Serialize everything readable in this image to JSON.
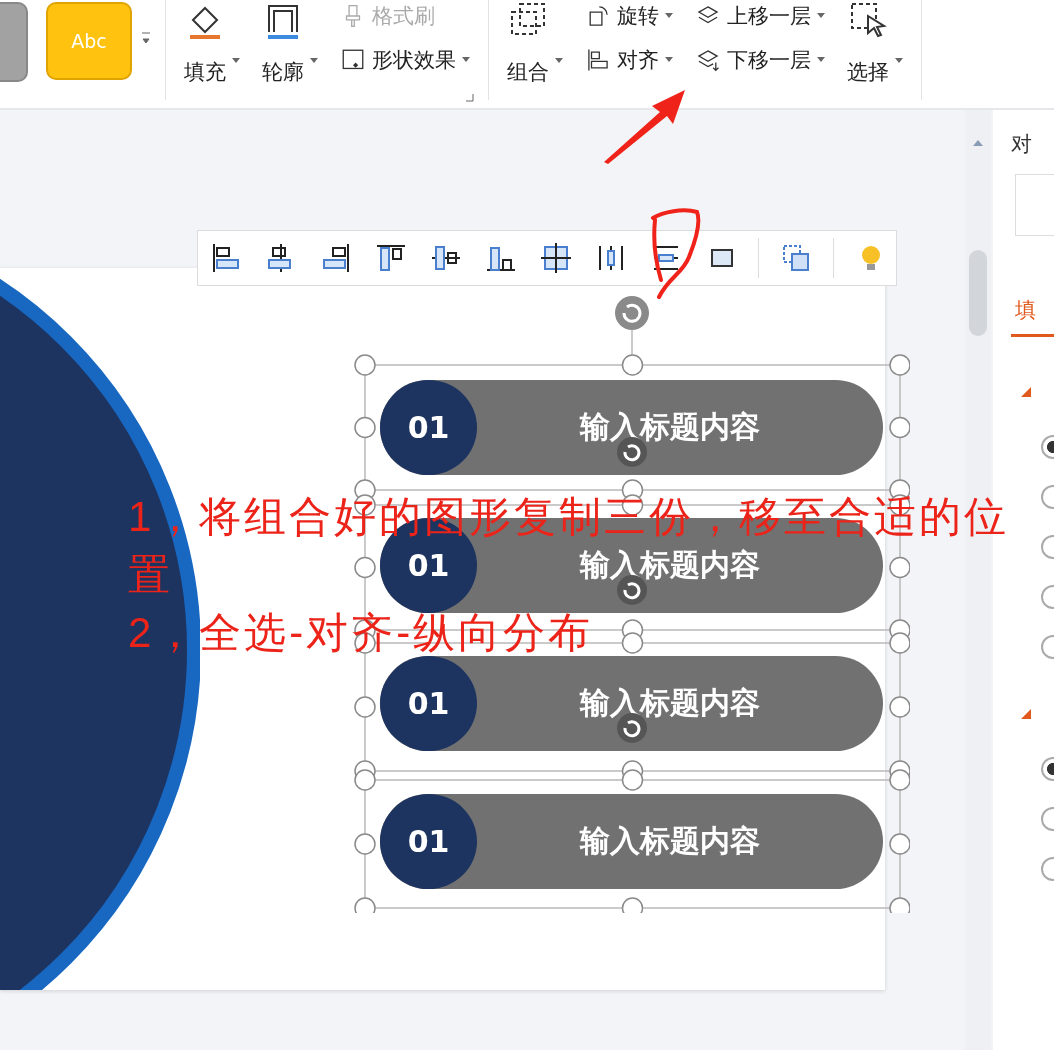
{
  "ribbon": {
    "style_preview": "Abc",
    "groups": [
      {
        "columns": [
          {
            "items": [
              {
                "kind": "fill",
                "label": "填充",
                "dropdown": true,
                "disabled": false
              }
            ]
          },
          {
            "items": [
              {
                "kind": "outline",
                "label": "轮廓",
                "dropdown": true,
                "disabled": false
              }
            ]
          },
          {
            "items": [
              {
                "kind": "brush",
                "label": "格式刷",
                "dropdown": false,
                "disabled": true
              },
              {
                "kind": "effects",
                "label": "形状效果",
                "dropdown": true,
                "disabled": false
              }
            ]
          }
        ]
      },
      {
        "columns": [
          {
            "items": [
              {
                "kind": "group",
                "label": "组合",
                "dropdown": true,
                "disabled": false
              }
            ]
          },
          {
            "items": [
              {
                "kind": "rotate",
                "label": "旋转",
                "dropdown": true,
                "disabled": false
              },
              {
                "kind": "align",
                "label": "对齐",
                "dropdown": true,
                "disabled": false
              }
            ]
          },
          {
            "items": [
              {
                "kind": "forward",
                "label": "上移一层",
                "dropdown": true,
                "disabled": false
              },
              {
                "kind": "backward",
                "label": "下移一层",
                "dropdown": true,
                "disabled": false
              }
            ]
          },
          {
            "items": [
              {
                "kind": "select",
                "label": "选择",
                "dropdown": true,
                "disabled": false
              }
            ]
          }
        ]
      }
    ]
  },
  "slide": {
    "items": [
      {
        "number": "01",
        "title": "输入标题内容"
      },
      {
        "number": "01",
        "title": "输入标题内容"
      },
      {
        "number": "01",
        "title": "输入标题内容"
      },
      {
        "number": "01",
        "title": "输入标题内容"
      }
    ]
  },
  "annotations": [
    "1，将组合好的图形复制三份，移至合适的位",
    "置",
    "2，全选-对齐-纵向分布"
  ],
  "side_panel": {
    "header": "对",
    "tabs": [
      {
        "label": "填",
        "selected": true
      }
    ],
    "sections": [
      {
        "options": [
          {
            "selected": true
          },
          {
            "selected": false
          },
          {
            "selected": false
          },
          {
            "selected": false
          },
          {
            "selected": false
          }
        ]
      },
      {
        "options": [
          {
            "selected": true
          },
          {
            "selected": false
          },
          {
            "selected": false
          }
        ]
      }
    ]
  }
}
